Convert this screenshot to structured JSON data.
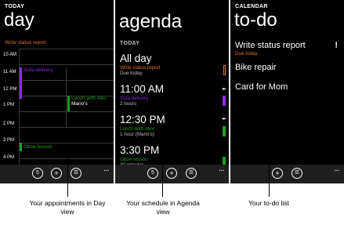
{
  "day": {
    "header": "TODAY",
    "title": "day",
    "allday_event": "Write status report",
    "hours": [
      "10 AM",
      "11 AM",
      "12 PM",
      "1 PM",
      "2 PM",
      "3 PM",
      "4 PM"
    ],
    "appointments": [
      {
        "label": "Sofa delivery",
        "color": "#8a2be2"
      },
      {
        "label": "Lunch with Alex",
        "detail": "Mario's",
        "color": "#1f9e1f"
      },
      {
        "label": "Oboe lesson",
        "color": "#1f9e1f"
      }
    ]
  },
  "agenda": {
    "title": "agenda",
    "section": "TODAY",
    "items": [
      {
        "time": "All day",
        "title": "Write status report",
        "detail": "Due today",
        "title_color": "#e8731b"
      },
      {
        "time": "11:00 AM",
        "title": "Sofa delivery",
        "detail": "2 hours",
        "title_color": "#8a2be2"
      },
      {
        "time": "12:30 PM",
        "title": "Lunch with Alex",
        "detail": "1 hour (Mario's)",
        "title_color": "#1f9e1f"
      },
      {
        "time": "3:30 PM",
        "title": "Oboe lesson",
        "detail": "30 minutes",
        "title_color": "#1f9e1f"
      }
    ]
  },
  "todo": {
    "header": "CALENDAR",
    "title": "to-do",
    "items": [
      {
        "label": "Write status report",
        "detail": "Due today",
        "priority": "!"
      },
      {
        "label": "Bike repair"
      },
      {
        "label": "Card for Mom"
      }
    ]
  },
  "appbar": {
    "today_label": "5",
    "more": "..."
  },
  "captions": {
    "day": "Your appointments in Day view",
    "agenda": "Your schedule in Agenda view",
    "todo": "Your to-do list"
  },
  "colors": {
    "orange": "#e8731b",
    "purple": "#8a2be2",
    "green": "#1f9e1f"
  }
}
